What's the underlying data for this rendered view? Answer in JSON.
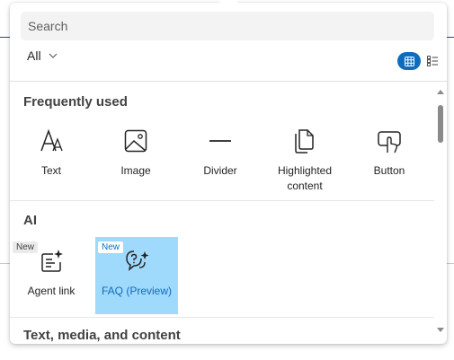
{
  "search": {
    "placeholder": "Search"
  },
  "filter": {
    "label": "All"
  },
  "sections": [
    {
      "title": "Frequently used",
      "items": [
        {
          "label": "Text",
          "icon": "text-icon"
        },
        {
          "label": "Image",
          "icon": "image-icon"
        },
        {
          "label": "Divider",
          "icon": "divider-icon"
        },
        {
          "label": "Highlighted content",
          "icon": "highlighted-content-icon"
        },
        {
          "label": "Button",
          "icon": "button-icon"
        }
      ]
    },
    {
      "title": "AI",
      "items": [
        {
          "label": "Agent link",
          "badge": "New",
          "icon": "agent-link-icon"
        },
        {
          "label": "FAQ (Preview)",
          "badge": "New",
          "icon": "faq-icon",
          "selected": true
        }
      ]
    },
    {
      "title": "Text, media, and content",
      "items": []
    }
  ],
  "colors": {
    "accent": "#0f6cbd",
    "selected_bg": "#9fd9fb"
  }
}
